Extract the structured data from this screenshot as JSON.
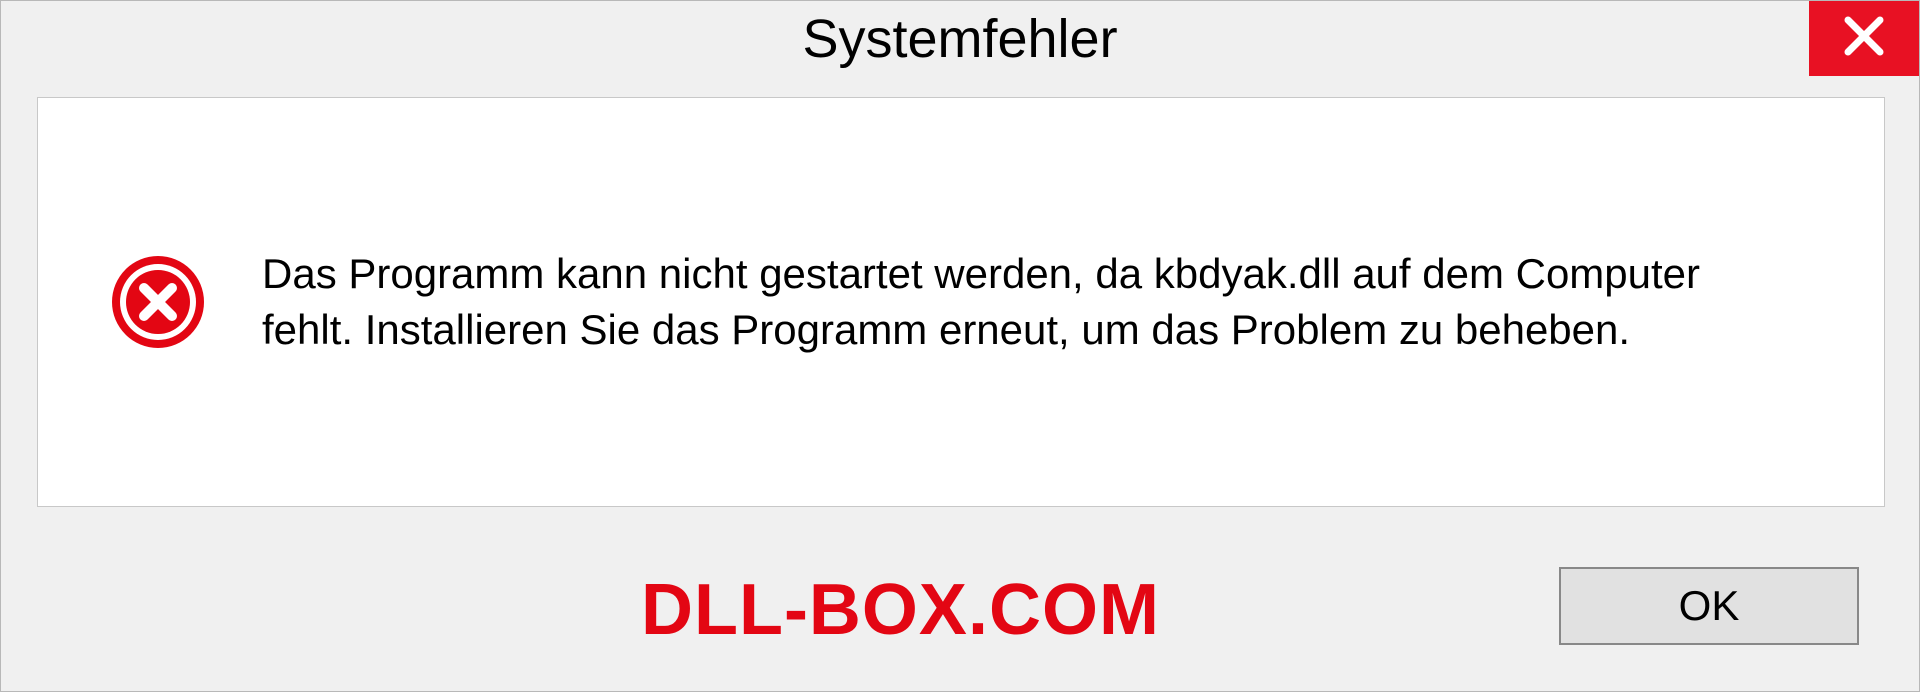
{
  "dialog": {
    "title": "Systemfehler",
    "message": "Das Programm kann nicht gestartet werden, da kbdyak.dll auf dem Computer fehlt. Installieren Sie das Programm erneut, um das Problem zu beheben.",
    "ok_label": "OK"
  },
  "watermark": "DLL-BOX.COM"
}
